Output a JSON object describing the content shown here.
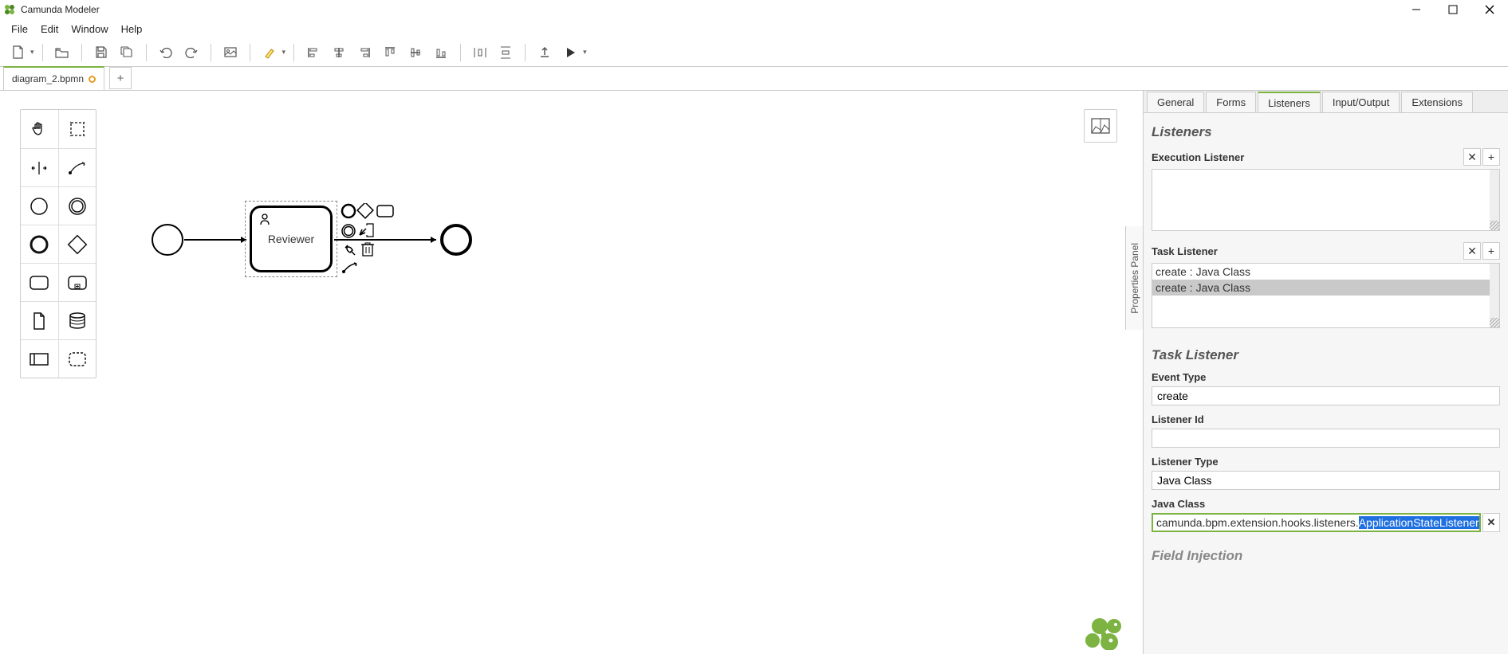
{
  "app": {
    "title": "Camunda Modeler"
  },
  "menu": {
    "file": "File",
    "edit": "Edit",
    "window": "Window",
    "help": "Help"
  },
  "tabs": {
    "active": "diagram_2.bpmn"
  },
  "diagram": {
    "task_label": "Reviewer"
  },
  "props": {
    "handle": "Properties Panel",
    "tabs": {
      "general": "General",
      "forms": "Forms",
      "listeners": "Listeners",
      "io": "Input/Output",
      "ext": "Extensions"
    },
    "section1": "Listeners",
    "exec_label": "Execution Listener",
    "task_list_label": "Task Listener",
    "task_list_items": [
      "create : Java Class",
      "create : Java Class"
    ],
    "section2": "Task Listener",
    "event_type_label": "Event Type",
    "event_type_value": "create",
    "listener_id_label": "Listener Id",
    "listener_id_value": "",
    "listener_type_label": "Listener Type",
    "listener_type_value": "Java Class",
    "java_class_label": "Java Class",
    "java_class_prefix": "camunda.bpm.extension.hooks.listeners.",
    "java_class_sel": "ApplicationStateListener",
    "next_section": "Field Injection"
  }
}
